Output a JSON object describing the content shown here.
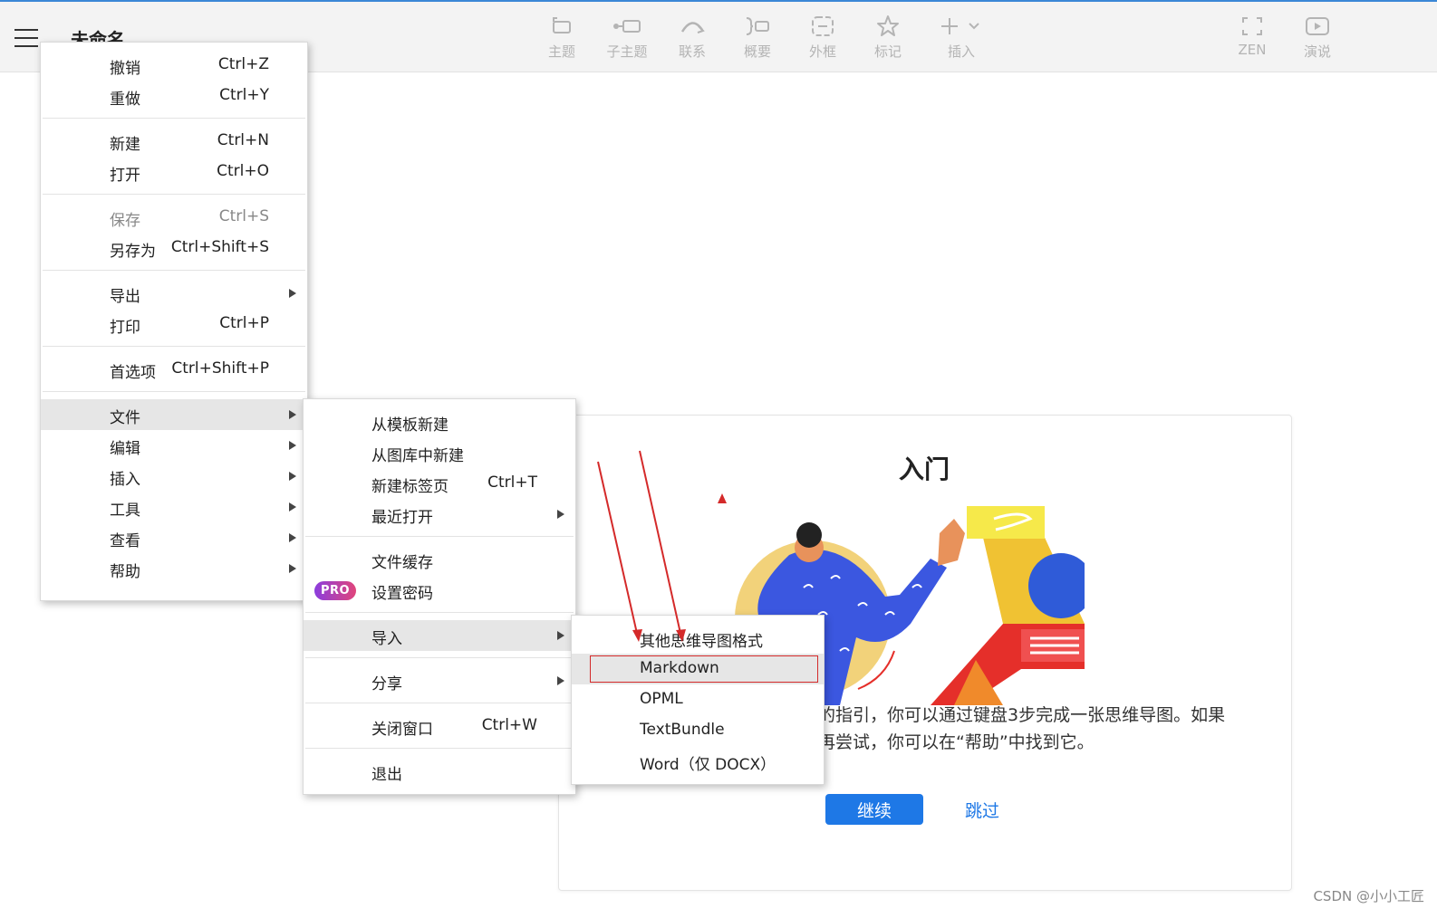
{
  "app": {
    "doc_title": "未命名"
  },
  "toolbar": {
    "topic": "主题",
    "subtopic": "子主题",
    "relationship": "联系",
    "summary": "概要",
    "boundary": "外框",
    "marker": "标记",
    "insert": "插入",
    "zen": "ZEN",
    "pitch": "演说"
  },
  "menu1": {
    "undo": {
      "label": "撤销",
      "shortcut": "Ctrl+Z"
    },
    "redo": {
      "label": "重做",
      "shortcut": "Ctrl+Y"
    },
    "new": {
      "label": "新建",
      "shortcut": "Ctrl+N"
    },
    "open": {
      "label": "打开",
      "shortcut": "Ctrl+O"
    },
    "save": {
      "label": "保存",
      "shortcut": "Ctrl+S"
    },
    "save_as": {
      "label": "另存为",
      "shortcut": "Ctrl+Shift+S"
    },
    "export": {
      "label": "导出"
    },
    "print": {
      "label": "打印",
      "shortcut": "Ctrl+P"
    },
    "preferences": {
      "label": "首选项",
      "shortcut": "Ctrl+Shift+P"
    },
    "file": {
      "label": "文件"
    },
    "edit": {
      "label": "编辑"
    },
    "insert": {
      "label": "插入"
    },
    "tools": {
      "label": "工具"
    },
    "view": {
      "label": "查看"
    },
    "help": {
      "label": "帮助"
    }
  },
  "menu2": {
    "new_from_template": {
      "label": "从模板新建"
    },
    "new_from_gallery": {
      "label": "从图库中新建"
    },
    "new_tab": {
      "label": "新建标签页",
      "shortcut": "Ctrl+T"
    },
    "recent": {
      "label": "最近打开"
    },
    "file_cache": {
      "label": "文件缓存"
    },
    "set_password": {
      "label": "设置密码",
      "badge": "PRO"
    },
    "import": {
      "label": "导入"
    },
    "share": {
      "label": "分享"
    },
    "close_window": {
      "label": "关闭窗口",
      "shortcut": "Ctrl+W"
    },
    "quit": {
      "label": "退出"
    }
  },
  "menu3": {
    "other_formats": {
      "label": "其他思维导图格式"
    },
    "markdown": {
      "label": "Markdown"
    },
    "opml": {
      "label": "OPML"
    },
    "textbundle": {
      "label": "TextBundle"
    },
    "word": {
      "label": "Word（仅 DOCX）"
    }
  },
  "onboarding": {
    "title": "入门",
    "desc_line1": "的指引，你可以通过键盘3步完成一张思维导图。如果",
    "desc_line2": "再尝试，你可以在“帮助”中找到它。",
    "continue_label": "继续",
    "skip_label": "跳过"
  },
  "watermark": "CSDN @小小工匠",
  "colors": {
    "accent": "#1e78e6",
    "annotation": "#d42a2a",
    "top_border": "#3b87d6"
  }
}
